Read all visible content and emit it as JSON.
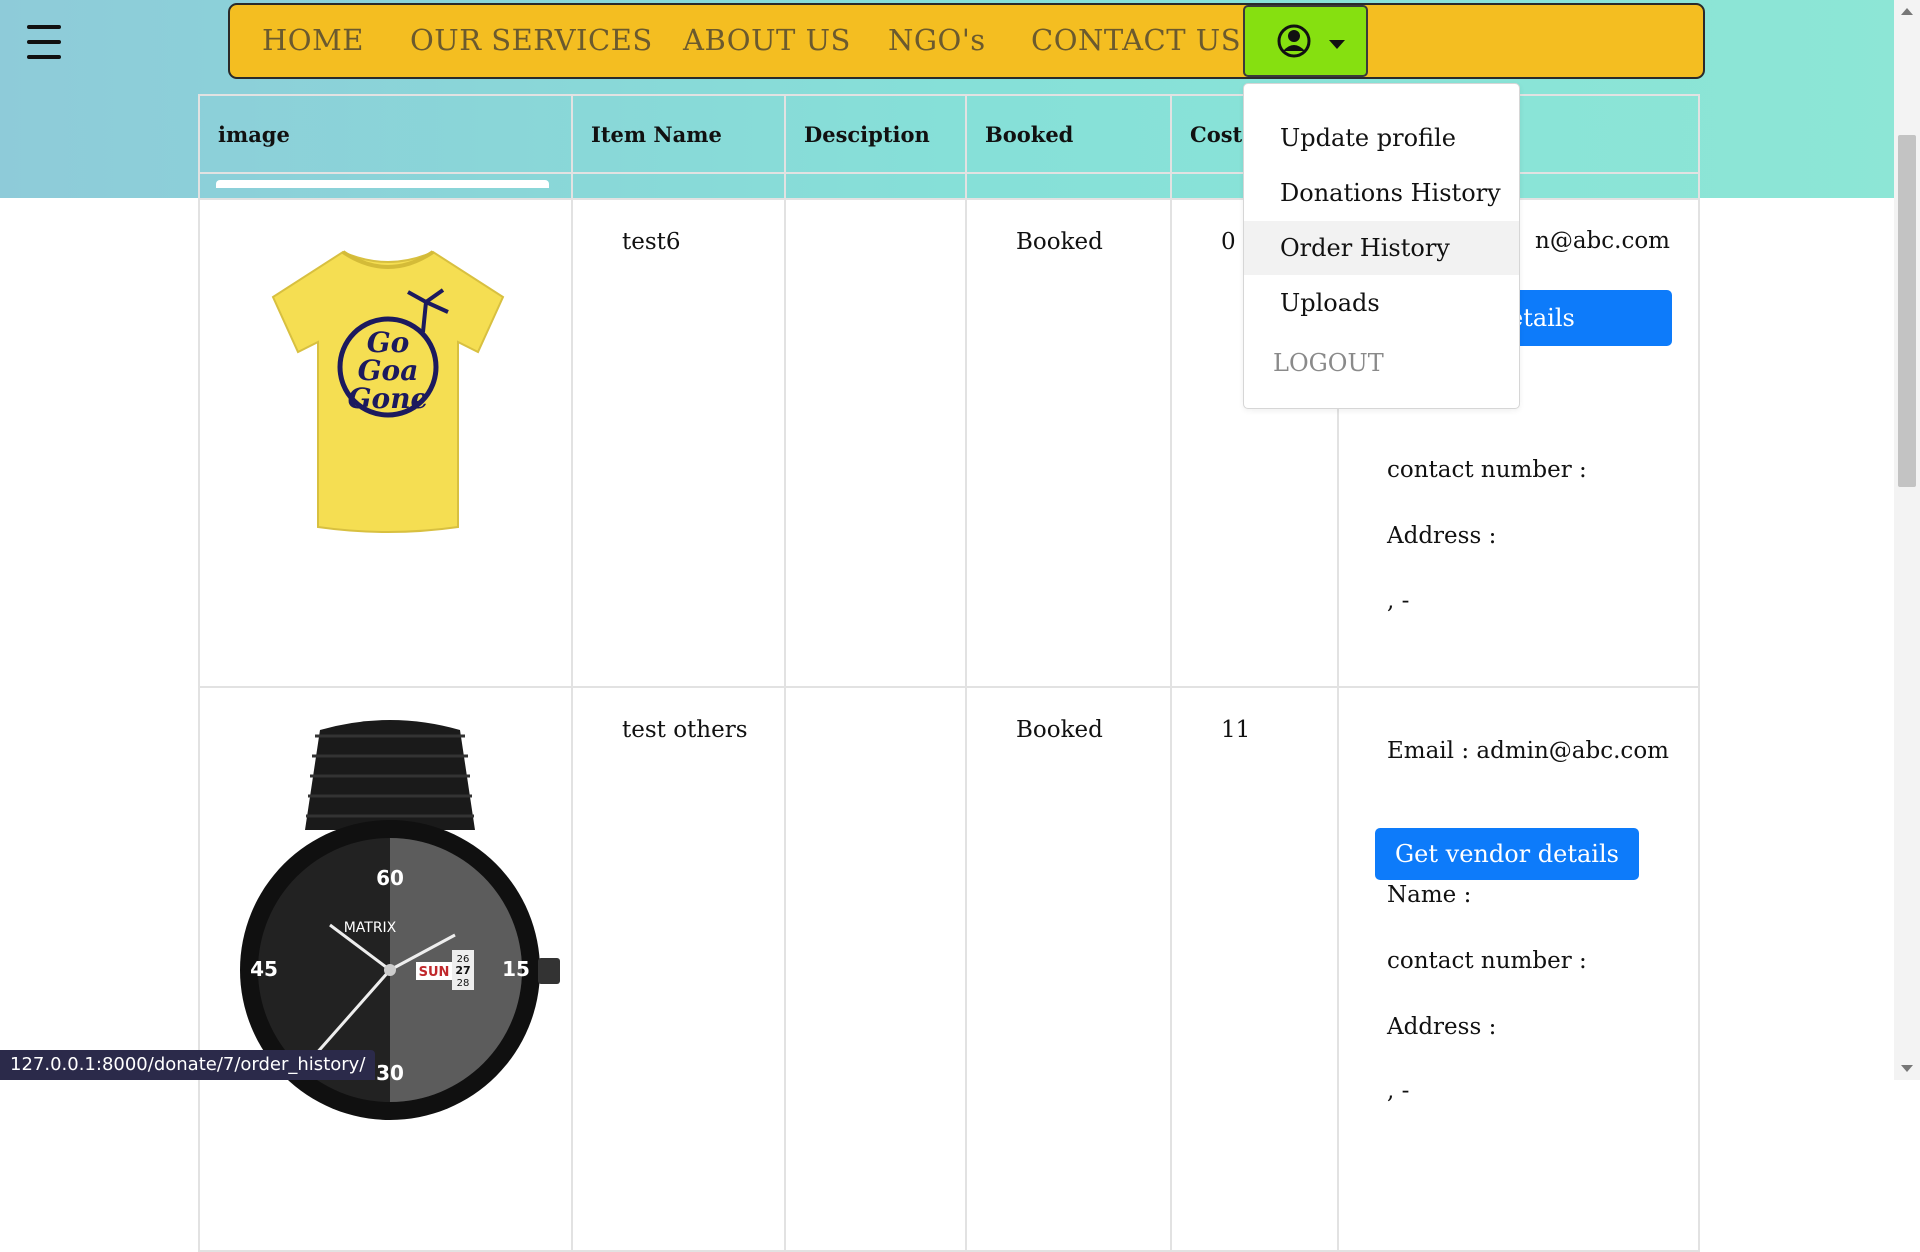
{
  "nav": {
    "links": [
      "HOME",
      "OUR SERVICES",
      "ABOUT US",
      "NGO's",
      "CONTACT US"
    ],
    "user_icon": "user-circle-icon",
    "caret_icon": "caret-down-icon",
    "menu_icon": "hamburger-menu-icon"
  },
  "dropdown": {
    "items": [
      "Update profile",
      "Donations History",
      "Order History",
      "Uploads"
    ],
    "active_item": "Order History",
    "logout": "LOGOUT"
  },
  "table": {
    "headers": [
      "image",
      "Item Name",
      "Desciption",
      "Booked",
      "Cost"
    ],
    "rows": [
      {
        "image": "yellow-tshirt-image",
        "item_name": "test6",
        "description": "",
        "booked": "Booked",
        "cost": "0",
        "email_visible": "n@abc.com",
        "vendor_button_visible": "etails",
        "contact": "contact number :",
        "address": "Address :",
        "address_value": ", -"
      },
      {
        "image": "black-watch-image",
        "item_name": "test others",
        "description": "",
        "booked": "Booked",
        "cost": "11",
        "email": "Email : admin@abc.com",
        "vendor_button": "Get vendor details",
        "name": "Name :",
        "contact": "contact number :",
        "address": "Address :",
        "address_value": ", -"
      }
    ]
  },
  "watch_labels": {
    "brand": "MATRIX",
    "day": "SUN",
    "dates": [
      "26",
      "27",
      "28"
    ],
    "minutes": [
      "60",
      "15",
      "30",
      "45"
    ]
  },
  "tshirt_print": "Go Goa Gone",
  "status_url": "127.0.0.1:8000/donate/7/order_history/",
  "colors": {
    "navbar": "#f4be21",
    "user_button": "#86e010",
    "primary_button": "#0d7bfa",
    "top_band": "#8ae0d8"
  }
}
